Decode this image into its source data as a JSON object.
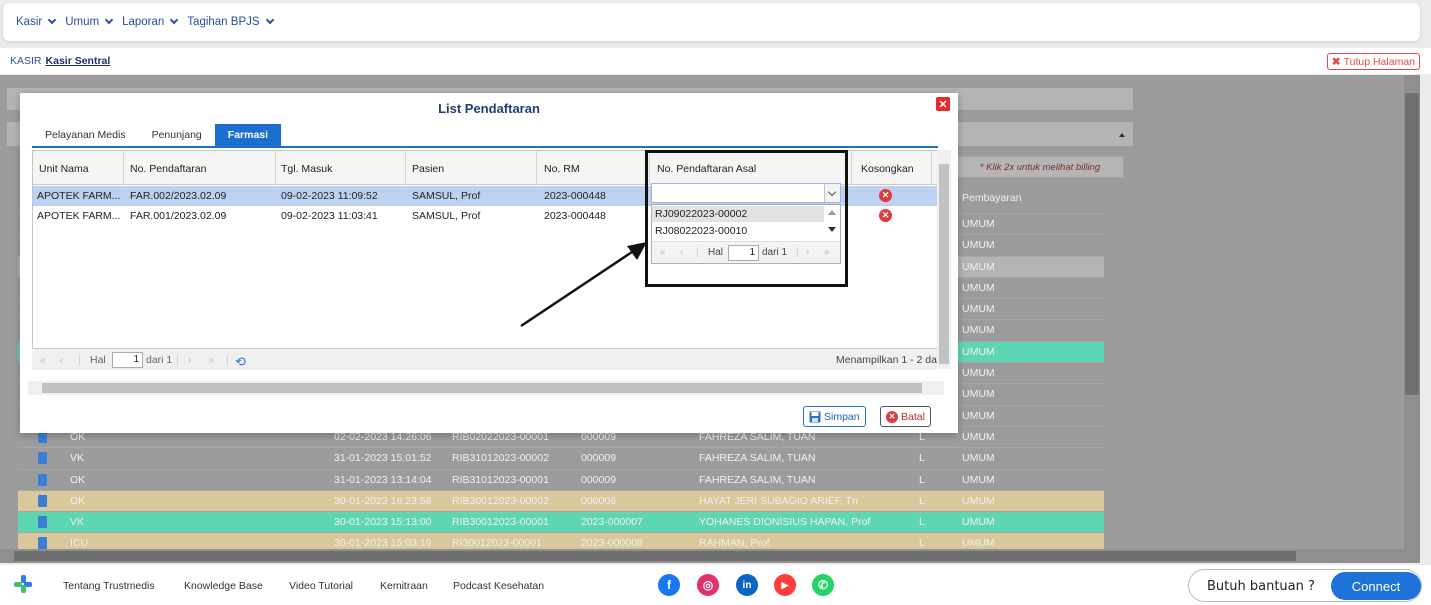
{
  "topnav": {
    "items": [
      {
        "label": "Kasir"
      },
      {
        "label": "Umum"
      },
      {
        "label": "Laporan"
      },
      {
        "label": "Tagihan BPJS"
      }
    ]
  },
  "breadcrumb": {
    "root": "KASIR",
    "current": "Kasir Sentral"
  },
  "close_page_label": "Tutup Halaman",
  "background": {
    "hint": "* Klik 2x untuk melihat billing",
    "header_col": "Pembayaran",
    "rows": [
      {
        "unit": "",
        "date": "",
        "reg": "",
        "rm": "",
        "name": "",
        "sex": "",
        "pay": "UMUM",
        "color": "#9c9c9c"
      },
      {
        "unit": "",
        "date": "",
        "reg": "",
        "rm": "",
        "name": "",
        "sex": "",
        "pay": "UMUM",
        "color": "#9c9c9c"
      },
      {
        "unit": "",
        "date": "",
        "reg": "",
        "rm": "",
        "name": "",
        "sex": "",
        "pay": "UMUM",
        "color": "#b2b4b6"
      },
      {
        "unit": "",
        "date": "",
        "reg": "",
        "rm": "",
        "name": "",
        "sex": "",
        "pay": "UMUM",
        "color": "#9c9c9c"
      },
      {
        "unit": "",
        "date": "",
        "reg": "",
        "rm": "",
        "name": "",
        "sex": "",
        "pay": "UMUM",
        "color": "#9c9c9c"
      },
      {
        "unit": "",
        "date": "",
        "reg": "",
        "rm": "",
        "name": "",
        "sex": "",
        "pay": "UMUM",
        "color": "#9c9c9c"
      },
      {
        "unit": "",
        "date": "",
        "reg": "",
        "rm": "",
        "name": "",
        "sex": "",
        "pay": "UMUM",
        "color": "#5fd6b3"
      },
      {
        "unit": "",
        "date": "",
        "reg": "",
        "rm": "",
        "name": "",
        "sex": "",
        "pay": "UMUM",
        "color": "#9c9c9c"
      },
      {
        "unit": "",
        "date": "",
        "reg": "",
        "rm": "",
        "name": "",
        "sex": "",
        "pay": "UMUM",
        "color": "#9c9c9c"
      },
      {
        "unit": "",
        "date": "",
        "reg": "",
        "rm": "",
        "name": "",
        "sex": "",
        "pay": "UMUM",
        "color": "#9c9c9c"
      },
      {
        "unit": "OK",
        "date": "02-02-2023 14:26:06",
        "reg": "RIB02022023-00001",
        "rm": "000009",
        "name": "FAHREZA SALIM, TUAN",
        "sex": "L",
        "pay": "UMUM",
        "color": "#9c9c9c"
      },
      {
        "unit": "VK",
        "date": "31-01-2023 15:01:52",
        "reg": "RIB31012023-00002",
        "rm": "000009",
        "name": "FAHREZA SALIM, TUAN",
        "sex": "L",
        "pay": "UMUM",
        "color": "#9c9c9c"
      },
      {
        "unit": "OK",
        "date": "31-01-2023 13:14:04",
        "reg": "RIB31012023-00001",
        "rm": "000009",
        "name": "FAHREZA SALIM, TUAN",
        "sex": "L",
        "pay": "UMUM",
        "color": "#9c9c9c"
      },
      {
        "unit": "OK",
        "date": "30-01-2023 16:23:58",
        "reg": "RIB30012023-00002",
        "rm": "000006",
        "name": "HAYAT JERI SUBAGIO ARIEF, Tn",
        "sex": "L",
        "pay": "UMUM",
        "color": "#d9c89b"
      },
      {
        "unit": "VK",
        "date": "30-01-2023 15:13:00",
        "reg": "RIB30012023-00001",
        "rm": "2023-000007",
        "name": "YOHANES DIONISIUS HAPAN, Prof",
        "sex": "L",
        "pay": "UMUM",
        "color": "#5fd6b3"
      },
      {
        "unit": "ICU",
        "date": "30-01-2023 15:03:19",
        "reg": "RI30012023-00001",
        "rm": "2023-000008",
        "name": "RAHMAN, Prof",
        "sex": "L",
        "pay": "UMUM",
        "color": "#d9c89b"
      }
    ]
  },
  "modal": {
    "title": "List Pendaftaran",
    "close_glyph": "✕",
    "tabs": [
      {
        "label": "Pelayanan Medis",
        "active": false
      },
      {
        "label": "Penunjang",
        "active": false
      },
      {
        "label": "Farmasi",
        "active": true
      }
    ],
    "columns": [
      "Unit Nama",
      "No. Pendaftaran",
      "Tgl. Masuk",
      "Pasien",
      "No. RM",
      "No. Pendaftaran Asal",
      "Kosongkan"
    ],
    "rows": [
      {
        "unit": "APOTEK FARM...",
        "reg": "FAR.002/2023.02.09",
        "date": "09-02-2023 11:09:52",
        "patient": "SAMSUL, Prof",
        "rm": "2023-000448",
        "asal": "",
        "selected": true
      },
      {
        "unit": "APOTEK FARM...",
        "reg": "FAR.001/2023.02.09",
        "date": "09-02-2023 11:03:41",
        "patient": "SAMSUL, Prof",
        "rm": "2023-000448",
        "asal": "",
        "selected": false
      }
    ],
    "pager": {
      "hal_label": "Hal",
      "page": "1",
      "of_label": "dari 1",
      "summary": "Menampilkan 1 - 2 da"
    },
    "buttons": {
      "save": "Simpan",
      "cancel": "Batal"
    },
    "combo": {
      "value": "",
      "options": [
        "RJ09022023-00002",
        "RJ08022023-00010"
      ],
      "pager": {
        "hal_label": "Hal",
        "page": "1",
        "of_label": "dari 1"
      }
    }
  },
  "footer": {
    "links": [
      "Tentang Trustmedis",
      "Knowledge Base",
      "Video Tutorial",
      "Kemitraan",
      "Podcast Kesehatan"
    ],
    "social": [
      {
        "name": "facebook-icon",
        "glyph": "f",
        "color": "#1877f2"
      },
      {
        "name": "instagram-icon",
        "glyph": "◎",
        "color": "#e1306c"
      },
      {
        "name": "linkedin-icon",
        "glyph": "in",
        "color": "#0a66c2"
      },
      {
        "name": "youtube-icon",
        "glyph": "▶",
        "color": "#ff3d3d"
      },
      {
        "name": "whatsapp-icon",
        "glyph": "✆",
        "color": "#25d366"
      }
    ],
    "help_label": "Butuh bantuan ?",
    "connect_label": "Connect"
  },
  "colors": {
    "accent": "#1d6fcf",
    "nav": "#2a4d9b",
    "danger": "#e0393e"
  }
}
